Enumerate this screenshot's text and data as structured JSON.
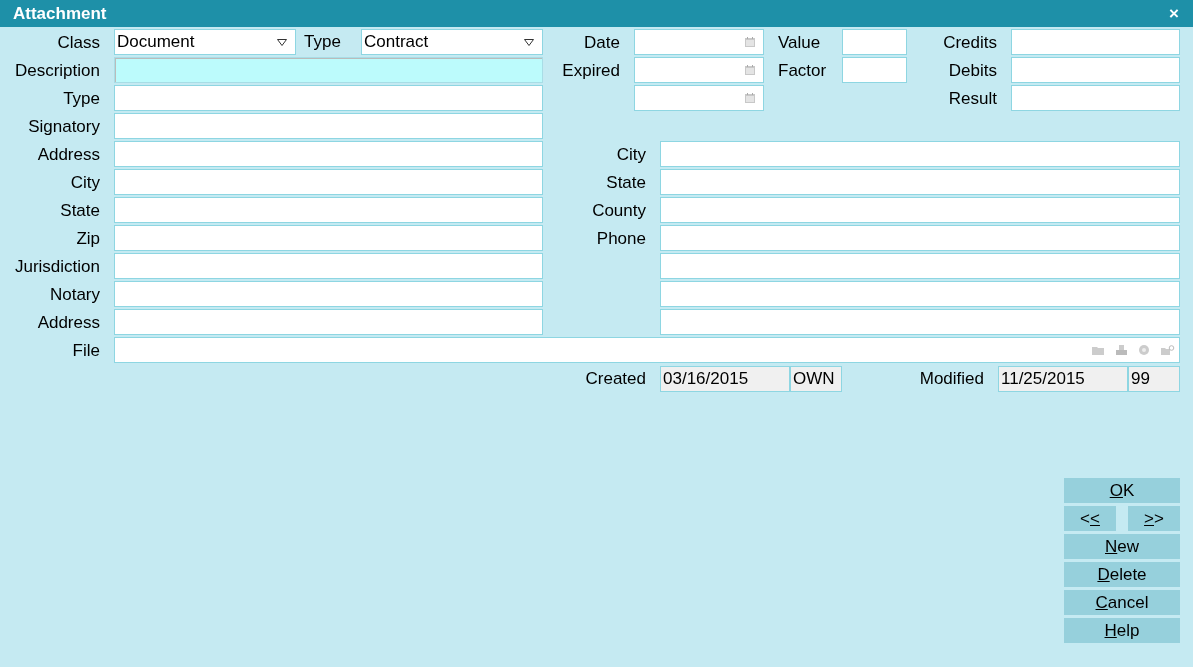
{
  "window": {
    "title": "Attachment",
    "close": "×"
  },
  "top_left": [
    {
      "kind": "combos",
      "items": [
        {
          "label": "Class",
          "value": "Document"
        },
        {
          "label": "Type",
          "value": "Contract"
        }
      ]
    },
    {
      "kind": "text",
      "label": "Description",
      "focused": true
    },
    {
      "kind": "text",
      "label": "Type",
      "focused": false
    }
  ],
  "dates": [
    {
      "kind": "labeled",
      "label": "Date"
    },
    {
      "kind": "labeled",
      "label": "Expired"
    },
    {
      "kind": "bare"
    }
  ],
  "numbers": [
    {
      "label": "Value"
    },
    {
      "label": "Factor"
    }
  ],
  "totals": [
    {
      "label": "Credits"
    },
    {
      "label": "Debits"
    },
    {
      "label": "Result"
    }
  ],
  "left_fields": [
    {
      "label": "Signatory"
    },
    {
      "label": "Address"
    },
    {
      "label": "City"
    },
    {
      "label": "State"
    },
    {
      "label": "Zip"
    },
    {
      "label": "Jurisdiction"
    },
    {
      "label": "Notary"
    },
    {
      "label": "Address"
    }
  ],
  "right_fields": [
    {
      "kind": "labeled",
      "label": "City"
    },
    {
      "kind": "labeled",
      "label": "State"
    },
    {
      "kind": "labeled",
      "label": "County"
    },
    {
      "kind": "labeled",
      "label": "Phone"
    },
    {
      "kind": "bare"
    },
    {
      "kind": "bare"
    },
    {
      "kind": "bare"
    }
  ],
  "file": {
    "label": "File"
  },
  "audit": {
    "created_label": "Created",
    "created_date": "03/16/2015",
    "created_by": "OWN",
    "modified_label": "Modified",
    "modified_date": "11/25/2015",
    "modified_by": "99"
  },
  "buttons": [
    [
      {
        "accel": "O",
        "post": "K"
      }
    ],
    [
      {
        "pre": "<",
        "accel": "<"
      },
      {
        "accel": ">",
        "post": ">"
      }
    ],
    [
      {
        "accel": "N",
        "post": "ew"
      }
    ],
    [
      {
        "accel": "D",
        "post": "elete"
      }
    ],
    [
      {
        "accel": "C",
        "post": "ancel"
      }
    ],
    [
      {
        "accel": "H",
        "post": "elp"
      }
    ]
  ]
}
